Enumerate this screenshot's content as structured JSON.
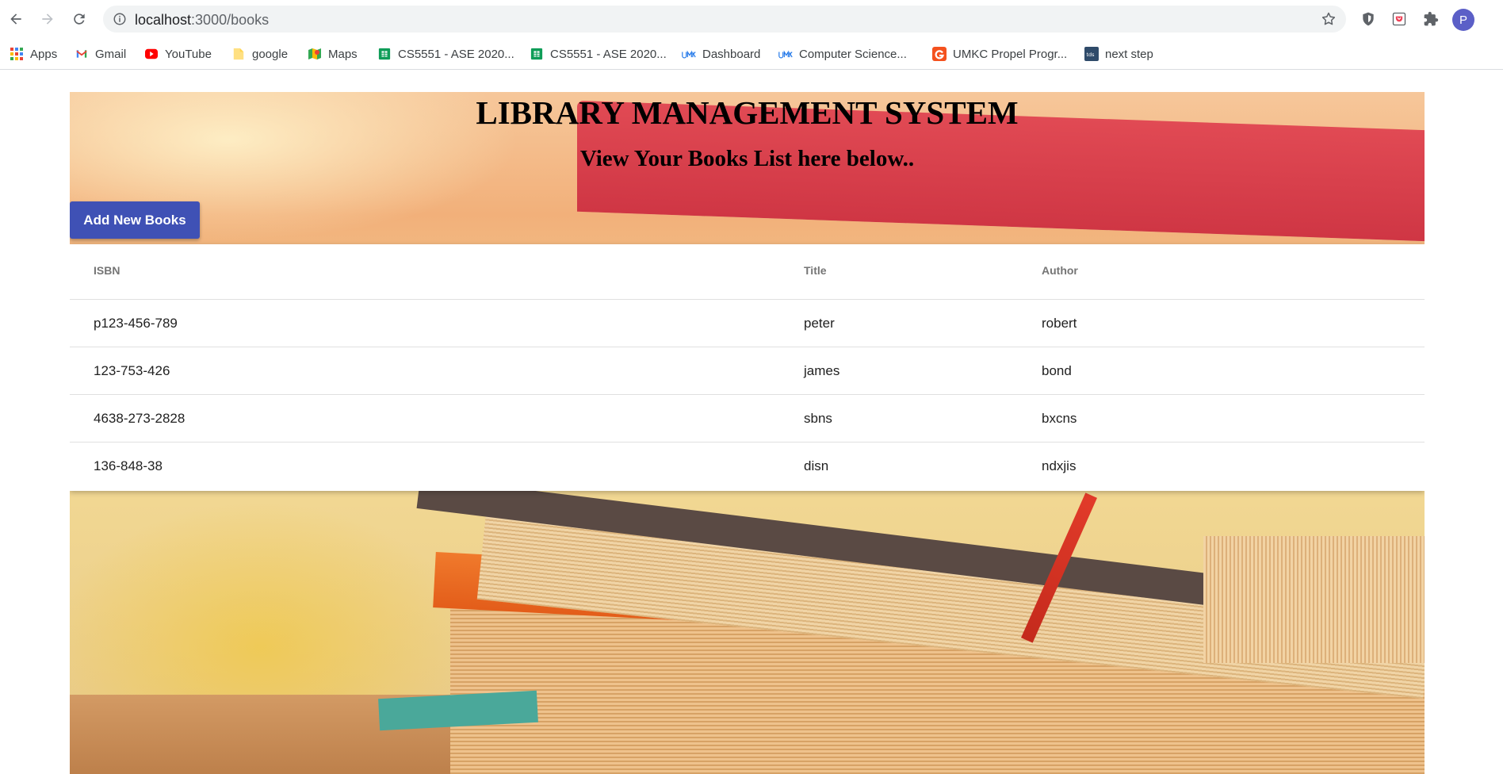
{
  "browser": {
    "url_host": "localhost",
    "url_path": ":3000/books",
    "profile_initial": "P",
    "bookmarks": [
      {
        "label": "Apps",
        "icon": "apps-grid-icon"
      },
      {
        "label": "Gmail",
        "icon": "gmail-icon"
      },
      {
        "label": "YouTube",
        "icon": "youtube-icon"
      },
      {
        "label": "google",
        "icon": "folder-icon"
      },
      {
        "label": "Maps",
        "icon": "maps-icon"
      },
      {
        "label": "CS5551 - ASE 2020...",
        "icon": "sheets-icon"
      },
      {
        "label": "CS5551 - ASE 2020...",
        "icon": "sheets-icon"
      },
      {
        "label": "Dashboard",
        "icon": "umkc-icon"
      },
      {
        "label": "Computer Science...",
        "icon": "umkc-icon"
      },
      {
        "label": "UMKC Propel Progr...",
        "icon": "g-icon"
      },
      {
        "label": "next step",
        "icon": "tds-icon"
      }
    ]
  },
  "page": {
    "title": "LIBRARY MANAGEMENT SYSTEM",
    "subtitle": "View Your Books List here below..",
    "add_button": "Add New Books",
    "table": {
      "headers": {
        "isbn": "ISBN",
        "title": "Title",
        "author": "Author"
      },
      "rows": [
        {
          "isbn": "p123-456-789",
          "title": "peter",
          "author": "robert"
        },
        {
          "isbn": "123-753-426",
          "title": "james",
          "author": "bond"
        },
        {
          "isbn": "4638-273-2828",
          "title": "sbns",
          "author": "bxcns"
        },
        {
          "isbn": "136-848-38",
          "title": "disn",
          "author": "ndxjis"
        }
      ]
    }
  },
  "colors": {
    "primary_button": "#3f51b5",
    "profile_avatar": "#5b5fc7"
  }
}
